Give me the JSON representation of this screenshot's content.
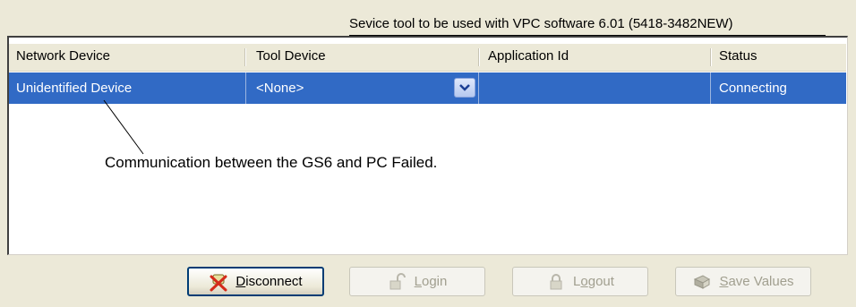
{
  "window": {
    "title": "Sevice tool to be used with VPC software 6.01 (5418-3482NEW)"
  },
  "grid": {
    "columns": [
      "Network Device",
      "Tool Device",
      "Application Id",
      "Status"
    ],
    "rows": [
      {
        "network_device": "Unidentified Device",
        "tool_device": "<None>",
        "application_id": "",
        "status": "Connecting",
        "selected": true
      }
    ]
  },
  "annotation": {
    "text": "Communication between the GS6 and PC Failed."
  },
  "buttons": {
    "disconnect": {
      "mnemonic": "D",
      "rest": "isconnect",
      "enabled": true,
      "icon": "disconnect-icon"
    },
    "login": {
      "mnemonic": "L",
      "rest": "ogin",
      "enabled": false,
      "icon": "unlock-icon"
    },
    "logout": {
      "prefix": "L",
      "mnemonic": "o",
      "rest": "gout",
      "enabled": false,
      "icon": "lock-icon"
    },
    "save_values": {
      "mnemonic": "S",
      "rest": "ave Values",
      "enabled": false,
      "icon": "save-values-icon"
    }
  },
  "colors": {
    "selection": "#316ac5",
    "face": "#ece9d8"
  }
}
